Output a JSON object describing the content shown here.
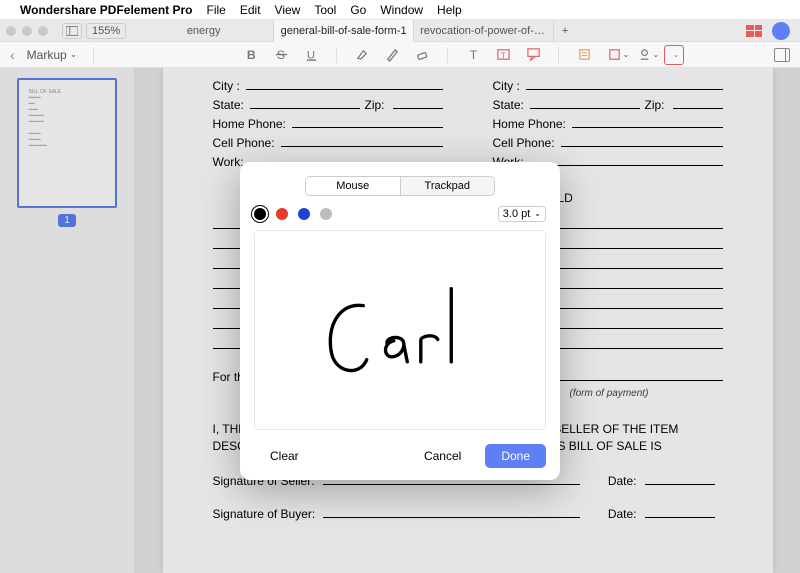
{
  "menubar": {
    "apple": "",
    "appname": "Wondershare PDFelement Pro",
    "items": [
      "File",
      "Edit",
      "View",
      "Tool",
      "Go",
      "Window",
      "Help"
    ]
  },
  "window": {
    "zoom": "155%",
    "tabs": [
      "energy",
      "general-bill-of-sale-form-1",
      "revocation-of-power-of-att..."
    ],
    "active_tab_index": 1,
    "add_tab": "+"
  },
  "toolbar": {
    "markup_label": "Markup",
    "chev": "﹀"
  },
  "sidebar": {
    "thumb_pagenum": "1"
  },
  "form": {
    "city": "City :",
    "state": "State:",
    "zip": "Zip:",
    "home_phone": "Home Phone:",
    "cell_phone": "Cell Phone:",
    "work": "Work:",
    "section_title": "DESCRIPTION OF ITEM BEING SOLD",
    "for_label": "For the Total Amount of ",
    "form_of_payment": "(form of payment)",
    "para": "I, THE UNDERSIGNED SELLER AM THE LAWFUL AND SOLE SELLER OF THE ITEM DESCRIBED WITH ITS ACCESSORIES AS CONTAINED IN THIS BILL OF SALE IS",
    "sig_seller": "Signature of Seller:",
    "sig_buyer": "Signature of Buyer:",
    "date": "Date:"
  },
  "dialog": {
    "seg_mouse": "Mouse",
    "seg_trackpad": "Trackpad",
    "size": "3.0 pt",
    "clear": "Clear",
    "cancel": "Cancel",
    "done": "Done",
    "signature_text": "Carl"
  }
}
